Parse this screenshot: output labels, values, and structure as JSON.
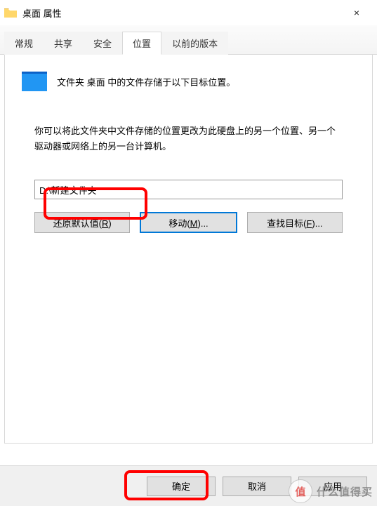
{
  "window": {
    "title": "桌面 属性",
    "close_label": "×"
  },
  "tabs": {
    "general": "常规",
    "sharing": "共享",
    "security": "安全",
    "location": "位置",
    "previous": "以前的版本"
  },
  "body": {
    "line1": "文件夹 桌面 中的文件存储于以下目标位置。",
    "line2": "你可以将此文件夹中文件存储的位置更改为此硬盘上的另一个位置、另一个驱动器或网络上的另一台计算机。",
    "path_value": "D:\\新建文件夹"
  },
  "buttons": {
    "restore_pre": "还原默认值(",
    "restore_m": "R",
    "restore_post": ")",
    "move_pre": "移动(",
    "move_m": "M",
    "move_post": ")...",
    "find_pre": "查找目标(",
    "find_m": "F",
    "find_post": ")..."
  },
  "footer": {
    "ok": "确定",
    "cancel": "取消",
    "apply": "应用"
  },
  "watermark": {
    "badge": "值",
    "text": "什么值得买"
  }
}
